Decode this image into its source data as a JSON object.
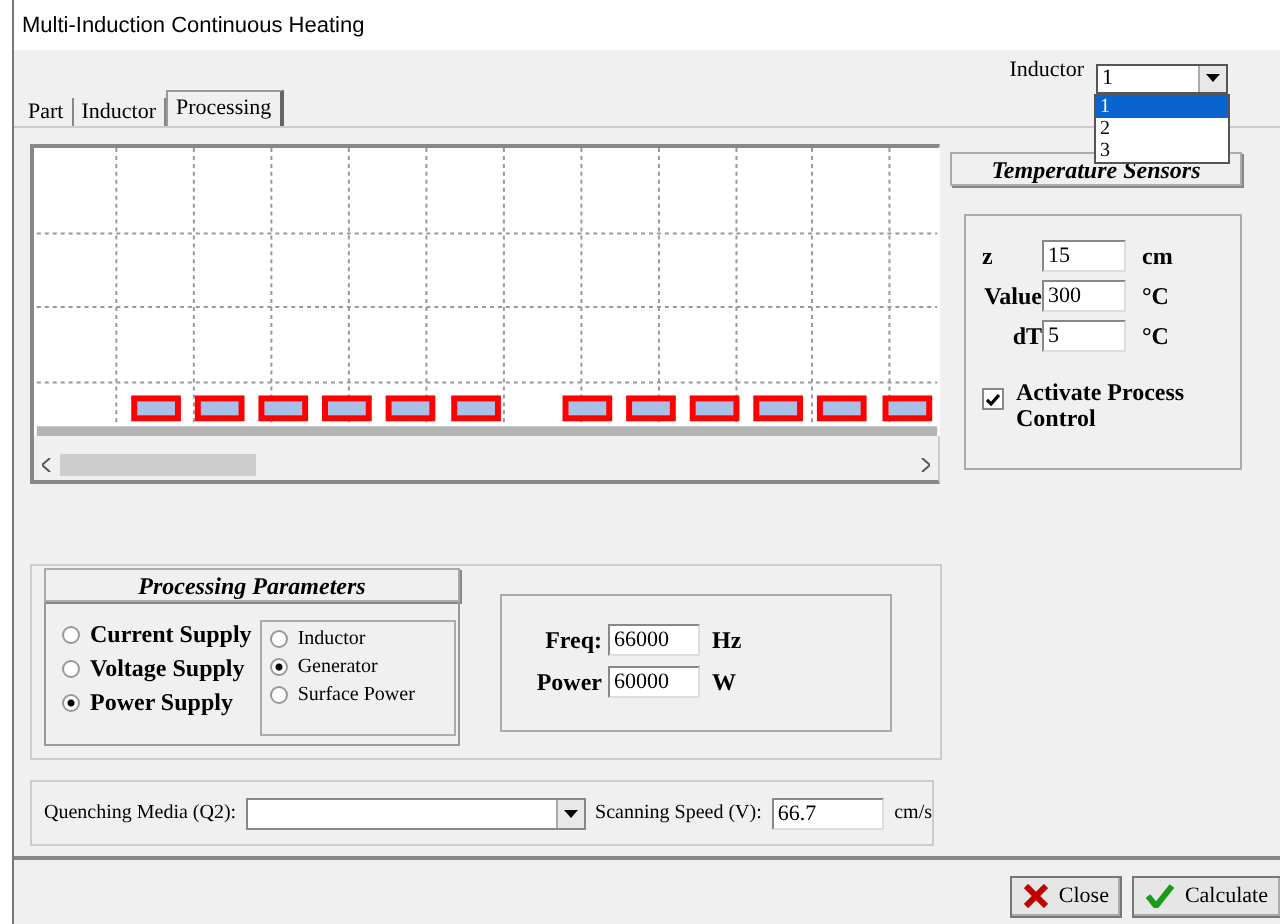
{
  "window": {
    "title": "Multi-Induction Continuous Heating"
  },
  "inductor_select": {
    "label": "Inductor",
    "value": "1",
    "options": [
      {
        "label": "1",
        "selected": true
      },
      {
        "label": "2",
        "selected": false
      },
      {
        "label": "3",
        "selected": false
      }
    ]
  },
  "tabs": [
    {
      "label": "Part",
      "selected": false
    },
    {
      "label": "Inductor",
      "selected": false
    },
    {
      "label": "Processing",
      "selected": true
    }
  ],
  "temperature_sensors": {
    "title": "Temperature Sensors",
    "fields": [
      {
        "label": "z",
        "value": "15",
        "unit": "cm"
      },
      {
        "label": "Value",
        "value": "300",
        "unit": "°C"
      },
      {
        "label": "dT",
        "value": "5",
        "unit": "°C"
      }
    ],
    "activate": {
      "label": "Activate Process Control",
      "checked": true
    }
  },
  "processing_parameters": {
    "title": "Processing Parameters",
    "supply": [
      {
        "label": "Current Supply",
        "selected": false
      },
      {
        "label": "Voltage Supply",
        "selected": false
      },
      {
        "label": "Power Supply",
        "selected": true
      }
    ],
    "reference": [
      {
        "label": "Inductor",
        "selected": false
      },
      {
        "label": "Generator",
        "selected": true
      },
      {
        "label": "Surface Power",
        "selected": false
      }
    ],
    "fields": [
      {
        "label": "Freq:",
        "value": "66000",
        "unit": "Hz"
      },
      {
        "label": "Power",
        "value": "60000",
        "unit": "W"
      }
    ]
  },
  "quenching": {
    "label": "Quenching Media (Q2):"
  },
  "scanning": {
    "label": "Scanning Speed (V):",
    "value": "66.7",
    "unit": "cm/s"
  },
  "buttons": [
    {
      "label": "Close",
      "kind": "close"
    },
    {
      "label": "Calculate",
      "kind": "calculate"
    }
  ]
}
